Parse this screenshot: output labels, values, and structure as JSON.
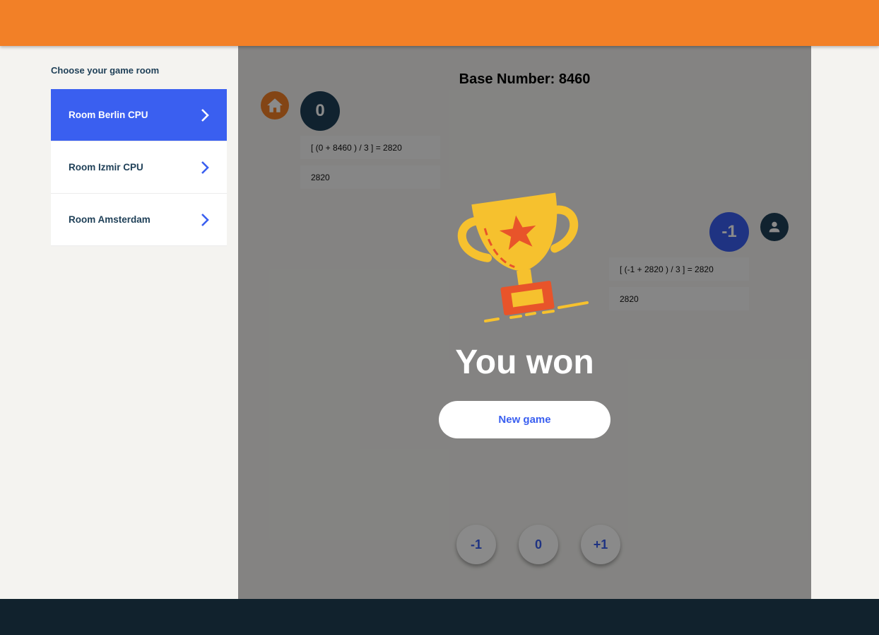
{
  "sidebar": {
    "title": "Choose your game room",
    "rooms": [
      {
        "label": "Room Berlin CPU",
        "active": true
      },
      {
        "label": "Room Izmir CPU",
        "active": false
      },
      {
        "label": "Room Amsterdam",
        "active": false
      }
    ]
  },
  "game": {
    "base_number": "Base Number: 8460",
    "cpu": {
      "avatar_icon": "home-icon",
      "move": "0",
      "calculation": "[ (0 + 8460 ) / 3 ] = 2820",
      "result": "2820"
    },
    "user": {
      "avatar_icon": "person-icon",
      "move": "-1",
      "calculation": "[ (-1 + 2820 ) / 3 ] = 2820",
      "result": "2820"
    },
    "moves": [
      "-1",
      "0",
      "+1"
    ]
  },
  "result_overlay": {
    "icon": "trophy-icon",
    "message": "You won",
    "button_label": "New game"
  },
  "colors": {
    "header": "#f28027",
    "footer": "#11222d",
    "accent": "#3a5ff0",
    "dark": "#1e3f57"
  }
}
